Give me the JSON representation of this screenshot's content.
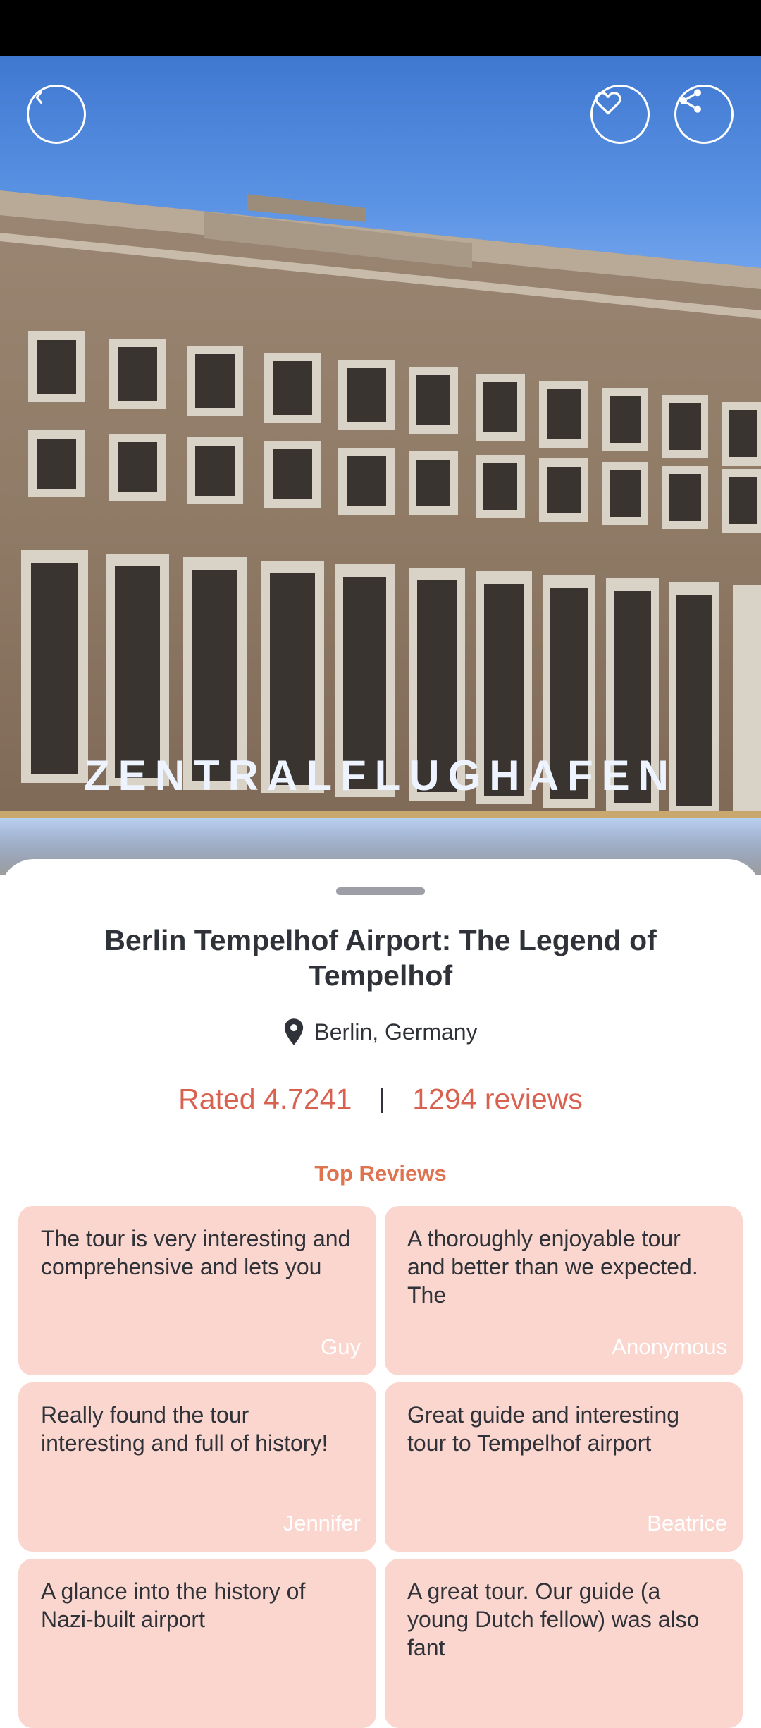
{
  "hero": {
    "building_sign": "ZENTRALFLUGHAFEN",
    "back_icon": "chevron-left-icon",
    "favorite_icon": "heart-icon",
    "share_icon": "share-icon"
  },
  "details": {
    "title": "Berlin Tempelhof Airport: The Legend of Tempelhof",
    "location": "Berlin, Germany",
    "location_icon": "map-pin-icon",
    "rating_text": "Rated 4.7241",
    "separator": "|",
    "reviews_text": "1294 reviews"
  },
  "top_reviews": {
    "heading": "Top Reviews",
    "items": [
      {
        "text": "The tour is very interesting and comprehensive and lets you",
        "author": "Guy"
      },
      {
        "text": "A thoroughly enjoyable tour and better than we expected. The",
        "author": "Anonymous"
      },
      {
        "text": "Really found the tour interesting and full of history!",
        "author": "Jennifer"
      },
      {
        "text": "Great guide and interesting tour to Tempelhof airport",
        "author": "Beatrice"
      },
      {
        "text": "A glance into the history of Nazi-built airport",
        "author": ""
      },
      {
        "text": "A great tour. Our guide (a young Dutch fellow) was also fant",
        "author": ""
      }
    ]
  },
  "colors": {
    "accent_text": "#d9614f",
    "heading_accent": "#e0734f",
    "card_background": "#fad6cf",
    "primary_text": "#2f3238"
  }
}
